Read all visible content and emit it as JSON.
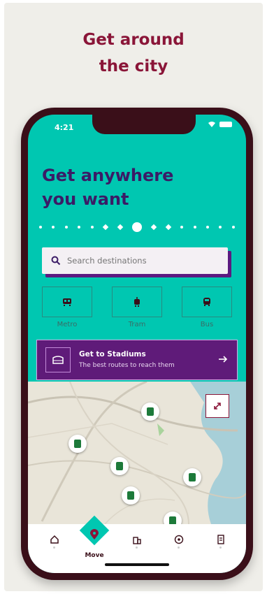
{
  "headline": {
    "line1": "Get around",
    "line2": "the city"
  },
  "status_bar": {
    "time": "4:21"
  },
  "hero": {
    "line1": "Get anywhere",
    "line2": "you want"
  },
  "search": {
    "placeholder": "Search destinations"
  },
  "modes": [
    {
      "label": "Metro",
      "icon": "metro-icon"
    },
    {
      "label": "Tram",
      "icon": "tram-icon"
    },
    {
      "label": "Bus",
      "icon": "bus-icon"
    }
  ],
  "stadium_card": {
    "title": "Get to Stadiums",
    "subtitle": "The best routes to reach them",
    "icon": "stadium-icon",
    "arrow_icon": "arrow-right-icon"
  },
  "map": {
    "expand_icon": "expand-icon"
  },
  "tabs": [
    {
      "name": "home",
      "icon": "home-icon",
      "label": ""
    },
    {
      "name": "move",
      "icon": "location-pin-icon",
      "label": "Move"
    },
    {
      "name": "places",
      "icon": "building-icon",
      "label": ""
    },
    {
      "name": "football",
      "icon": "football-icon",
      "label": ""
    },
    {
      "name": "tickets",
      "icon": "ticket-icon",
      "label": ""
    }
  ],
  "colors": {
    "brand_maroon": "#8a1538",
    "teal": "#00c7b1",
    "purple": "#5f1b79",
    "hero_text": "#3b1b66"
  }
}
